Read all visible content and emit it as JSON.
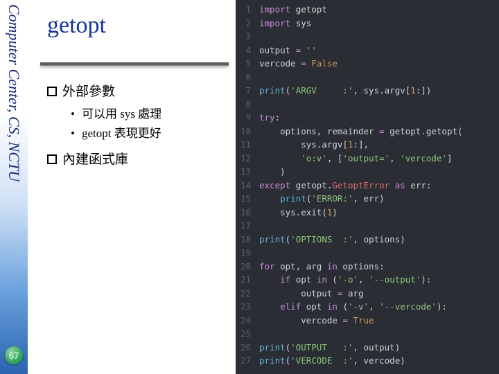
{
  "sidebar": {
    "org": "Computer Center, CS, NCTU",
    "page": "67"
  },
  "title": "getopt",
  "bullets": {
    "b1": "外部參數",
    "b1_sub": [
      "可以用 sys 處理",
      "getopt 表現更好"
    ],
    "b2": "內建函式庫"
  },
  "code": {
    "lines": [
      [
        {
          "c": "kw",
          "t": "import "
        },
        {
          "c": "mod",
          "t": "getopt"
        }
      ],
      [
        {
          "c": "kw",
          "t": "import "
        },
        {
          "c": "mod",
          "t": "sys"
        }
      ],
      [],
      [
        {
          "c": "cm",
          "t": "output "
        },
        {
          "c": "kw",
          "t": "= "
        },
        {
          "c": "st",
          "t": "''"
        }
      ],
      [
        {
          "c": "cm",
          "t": "vercode "
        },
        {
          "c": "kw",
          "t": "= "
        },
        {
          "c": "bl",
          "t": "False"
        }
      ],
      [],
      [
        {
          "c": "fn",
          "t": "print"
        },
        {
          "c": "cm",
          "t": "("
        },
        {
          "c": "st",
          "t": "'ARGV     :'"
        },
        {
          "c": "cm",
          "t": ", sys.argv["
        },
        {
          "c": "nm",
          "t": "1"
        },
        {
          "c": "cm",
          "t": ":])"
        }
      ],
      [],
      [
        {
          "c": "kw",
          "t": "try"
        },
        {
          "c": "cm",
          "t": ":"
        }
      ],
      [
        {
          "c": "cm",
          "t": "    options, remainder "
        },
        {
          "c": "kw",
          "t": "= "
        },
        {
          "c": "cm",
          "t": "getopt.getopt("
        }
      ],
      [
        {
          "c": "cm",
          "t": "        sys.argv["
        },
        {
          "c": "nm",
          "t": "1"
        },
        {
          "c": "cm",
          "t": ":],"
        }
      ],
      [
        {
          "c": "cm",
          "t": "        "
        },
        {
          "c": "st",
          "t": "'o:v'"
        },
        {
          "c": "cm",
          "t": ", ["
        },
        {
          "c": "st",
          "t": "'output='"
        },
        {
          "c": "cm",
          "t": ", "
        },
        {
          "c": "st",
          "t": "'vercode'"
        },
        {
          "c": "cm",
          "t": "]"
        }
      ],
      [
        {
          "c": "cm",
          "t": "    )"
        }
      ],
      [
        {
          "c": "kw",
          "t": "except"
        },
        {
          "c": "cm",
          "t": " getopt."
        },
        {
          "c": "va",
          "t": "GetoptError"
        },
        {
          "c": "cm",
          "t": " "
        },
        {
          "c": "kw",
          "t": "as"
        },
        {
          "c": "cm",
          "t": " err:"
        }
      ],
      [
        {
          "c": "cm",
          "t": "    "
        },
        {
          "c": "fn",
          "t": "print"
        },
        {
          "c": "cm",
          "t": "("
        },
        {
          "c": "st",
          "t": "'ERROR:'"
        },
        {
          "c": "cm",
          "t": ", err)"
        }
      ],
      [
        {
          "c": "cm",
          "t": "    sys.exit("
        },
        {
          "c": "nm",
          "t": "1"
        },
        {
          "c": "cm",
          "t": ")"
        }
      ],
      [],
      [
        {
          "c": "fn",
          "t": "print"
        },
        {
          "c": "cm",
          "t": "("
        },
        {
          "c": "st",
          "t": "'OPTIONS  :'"
        },
        {
          "c": "cm",
          "t": ", options)"
        }
      ],
      [],
      [
        {
          "c": "kw",
          "t": "for"
        },
        {
          "c": "cm",
          "t": " opt, arg "
        },
        {
          "c": "kw",
          "t": "in"
        },
        {
          "c": "cm",
          "t": " options:"
        }
      ],
      [
        {
          "c": "cm",
          "t": "    "
        },
        {
          "c": "kw",
          "t": "if"
        },
        {
          "c": "cm",
          "t": " opt "
        },
        {
          "c": "kw",
          "t": "in"
        },
        {
          "c": "cm",
          "t": " ("
        },
        {
          "c": "st",
          "t": "'-o'"
        },
        {
          "c": "cm",
          "t": ", "
        },
        {
          "c": "st",
          "t": "'--output'"
        },
        {
          "c": "cm",
          "t": "):"
        }
      ],
      [
        {
          "c": "cm",
          "t": "        output "
        },
        {
          "c": "kw",
          "t": "= "
        },
        {
          "c": "cm",
          "t": "arg"
        }
      ],
      [
        {
          "c": "cm",
          "t": "    "
        },
        {
          "c": "kw",
          "t": "elif"
        },
        {
          "c": "cm",
          "t": " opt "
        },
        {
          "c": "kw",
          "t": "in"
        },
        {
          "c": "cm",
          "t": " ("
        },
        {
          "c": "st",
          "t": "'-v'"
        },
        {
          "c": "cm",
          "t": ", "
        },
        {
          "c": "st",
          "t": "'--vercode'"
        },
        {
          "c": "cm",
          "t": "):"
        }
      ],
      [
        {
          "c": "cm",
          "t": "        vercode "
        },
        {
          "c": "kw",
          "t": "= "
        },
        {
          "c": "bl",
          "t": "True"
        }
      ],
      [],
      [
        {
          "c": "fn",
          "t": "print"
        },
        {
          "c": "cm",
          "t": "("
        },
        {
          "c": "st",
          "t": "'OUTPUT   :'"
        },
        {
          "c": "cm",
          "t": ", output)"
        }
      ],
      [
        {
          "c": "fn",
          "t": "print"
        },
        {
          "c": "cm",
          "t": "("
        },
        {
          "c": "st",
          "t": "'VERCODE  :'"
        },
        {
          "c": "cm",
          "t": ", vercode)"
        }
      ]
    ]
  }
}
